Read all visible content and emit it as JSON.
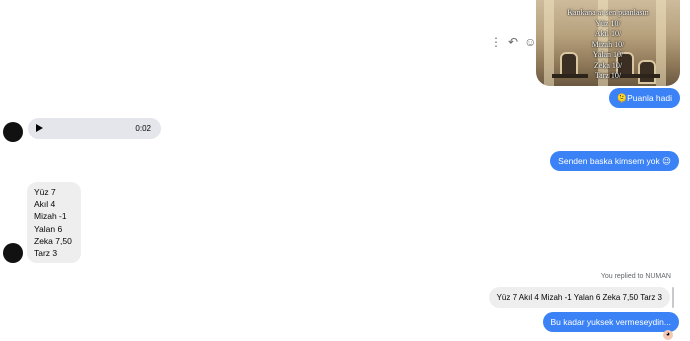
{
  "photo_message": {
    "lines": [
      "Kankana at sen puanlasın",
      "Yüz 10/",
      "Akıl 10/",
      "Mizah 10/",
      "Yalan 10/",
      "Zeka 10/",
      "Tarz 10/"
    ]
  },
  "actions": {
    "more_icon": "more-vertical-icon",
    "reply_icon": "reply-icon",
    "react_icon": "smile-icon"
  },
  "messages": {
    "puanla": {
      "emoji": "🫠",
      "text": "Puanla hadi"
    },
    "voice": {
      "duration": "0:02"
    },
    "senden": {
      "text": "Senden baska kimsem yok",
      "emoji": "😉"
    },
    "stats": [
      "Yüz 7",
      "Akıl 4",
      "Mizah -1",
      "Yalan 6",
      "Zeka 7,50",
      "Tarz 3"
    ],
    "replied_label": "You replied to NUMAN",
    "quoted": "Yüz 7 Akıl 4 Mizah -1 Yalan 6 Zeka 7,50 Tarz 3",
    "last": "Bu kadar yuksek vermeseydin..."
  },
  "colors": {
    "outgoing_bubble": "#3b82f6",
    "incoming_bubble": "#eeeeee"
  }
}
